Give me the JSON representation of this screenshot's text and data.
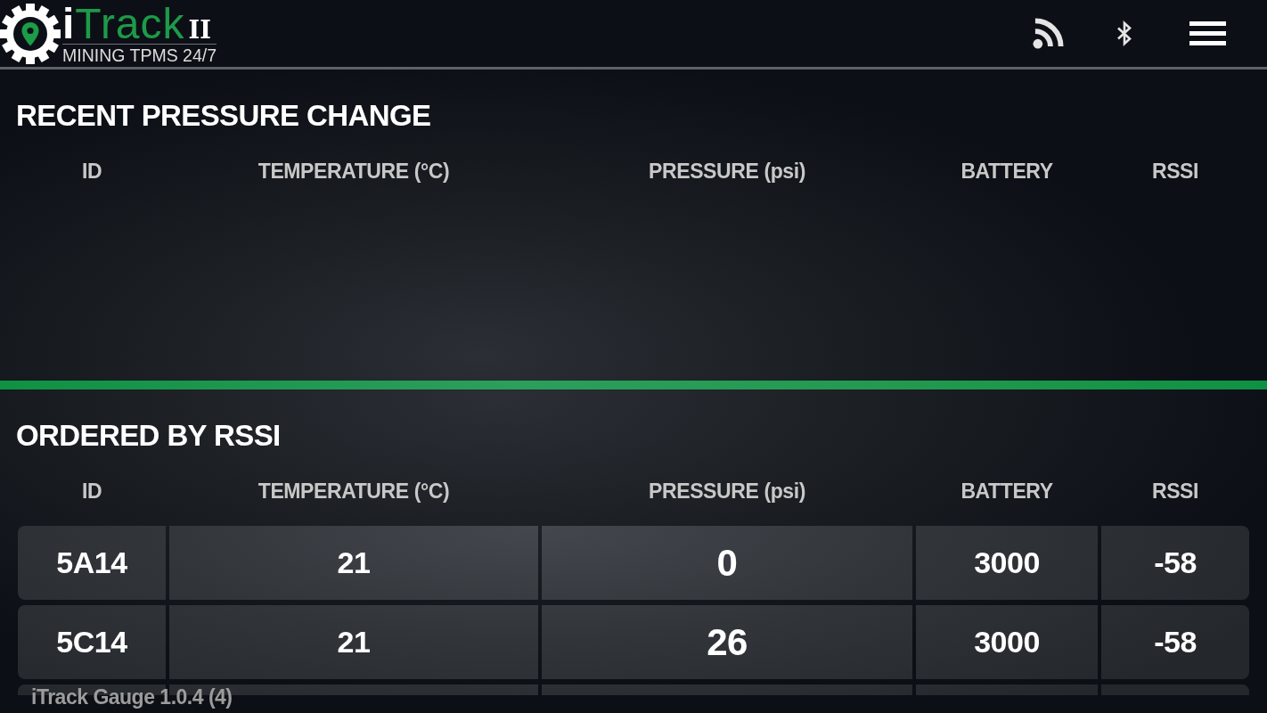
{
  "app_bar": {
    "logo": {
      "title_lead": "i",
      "title_main": "Track",
      "edition": "II",
      "tagline": "MINING TPMS 24/7"
    }
  },
  "sections": [
    {
      "title": "RECENT PRESSURE CHANGE",
      "columns": [
        "ID",
        "TEMPERATURE (°C)",
        "PRESSURE (psi)",
        "BATTERY",
        "RSSI"
      ]
    },
    {
      "title": "ORDERED BY RSSI",
      "columns": [
        "ID",
        "TEMPERATURE (°C)",
        "PRESSURE (psi)",
        "BATTERY",
        "RSSI"
      ],
      "rows": [
        {
          "cells": [
            "5A14",
            "21",
            "0",
            "3000",
            "-58"
          ]
        },
        {
          "cells": [
            "5C14",
            "21",
            "26",
            "3000",
            "-58"
          ]
        }
      ],
      "rows_continue": true
    }
  ],
  "footer": {
    "version": "iTrack Gauge 1.0.4 (4)"
  }
}
